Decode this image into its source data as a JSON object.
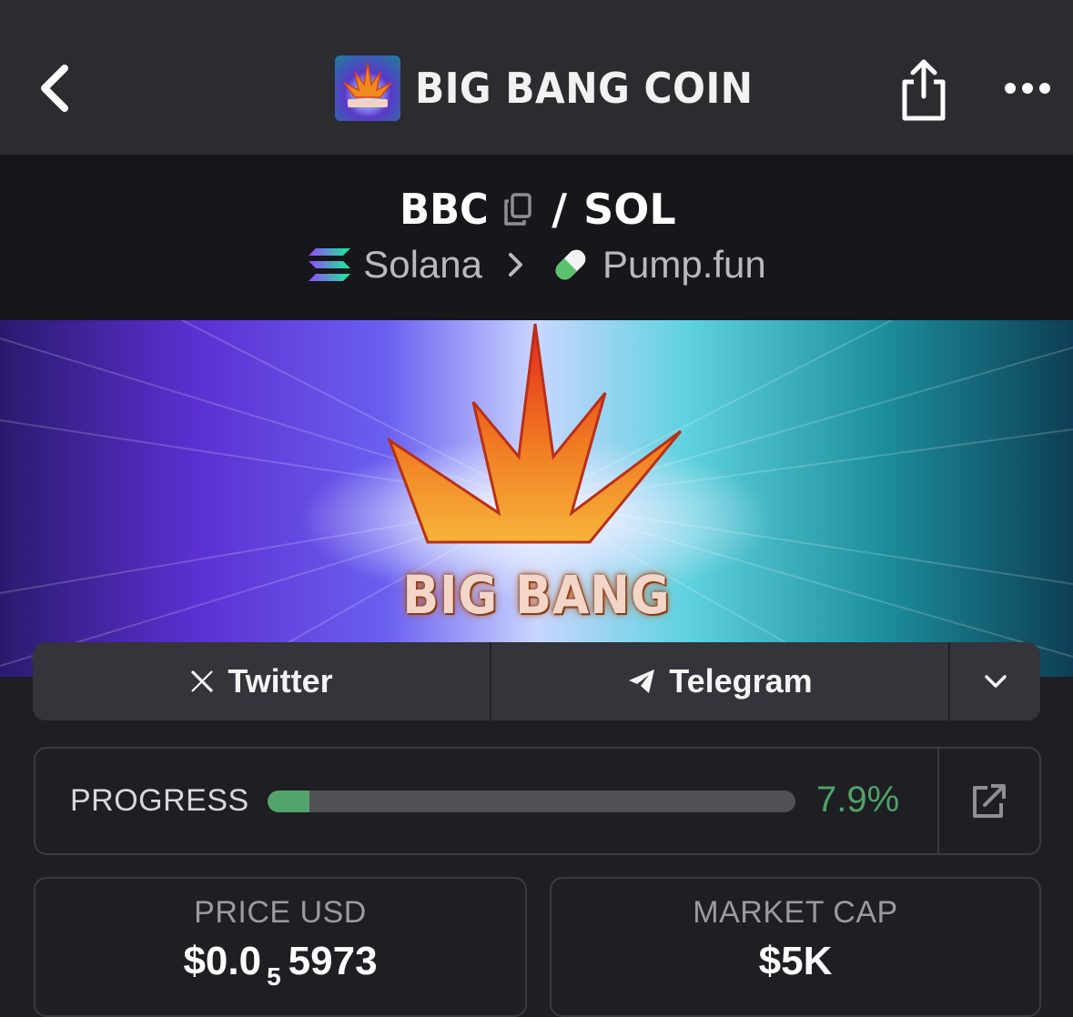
{
  "topbar": {
    "title": "BIG BANG COIN",
    "icons": {
      "back": "chevron-left-icon",
      "share": "share-icon",
      "more": "more-horizontal-icon"
    }
  },
  "pair": {
    "base": "BBC",
    "separator": "/",
    "quote": "SOL",
    "chain": "Solana",
    "dex": "Pump.fun",
    "icons": {
      "copy": "copy-icon",
      "chain": "solana-icon",
      "dex": "pill-icon",
      "chevron": "chevron-right-icon"
    }
  },
  "banner": {
    "text": "BIG BANG"
  },
  "social": {
    "twitter_label": "Twitter",
    "telegram_label": "Telegram",
    "icons": {
      "twitter": "x-icon",
      "telegram": "telegram-icon",
      "expand": "chevron-down-icon"
    }
  },
  "progress": {
    "label": "PROGRESS",
    "value_text": "7.9%",
    "fraction": 0.079,
    "icon": "external-link-icon"
  },
  "stats": {
    "price": {
      "label": "PRICE USD",
      "prefix": "$0.0",
      "subscript": "5",
      "suffix": "5973"
    },
    "market_cap": {
      "label": "MARKET CAP",
      "value": "$5K"
    }
  },
  "colors": {
    "background": "#1e1e23",
    "topbar": "#2b2b30",
    "pairbar": "#17171b",
    "accent_green": "#4fa367",
    "progress_track": "#505055"
  }
}
